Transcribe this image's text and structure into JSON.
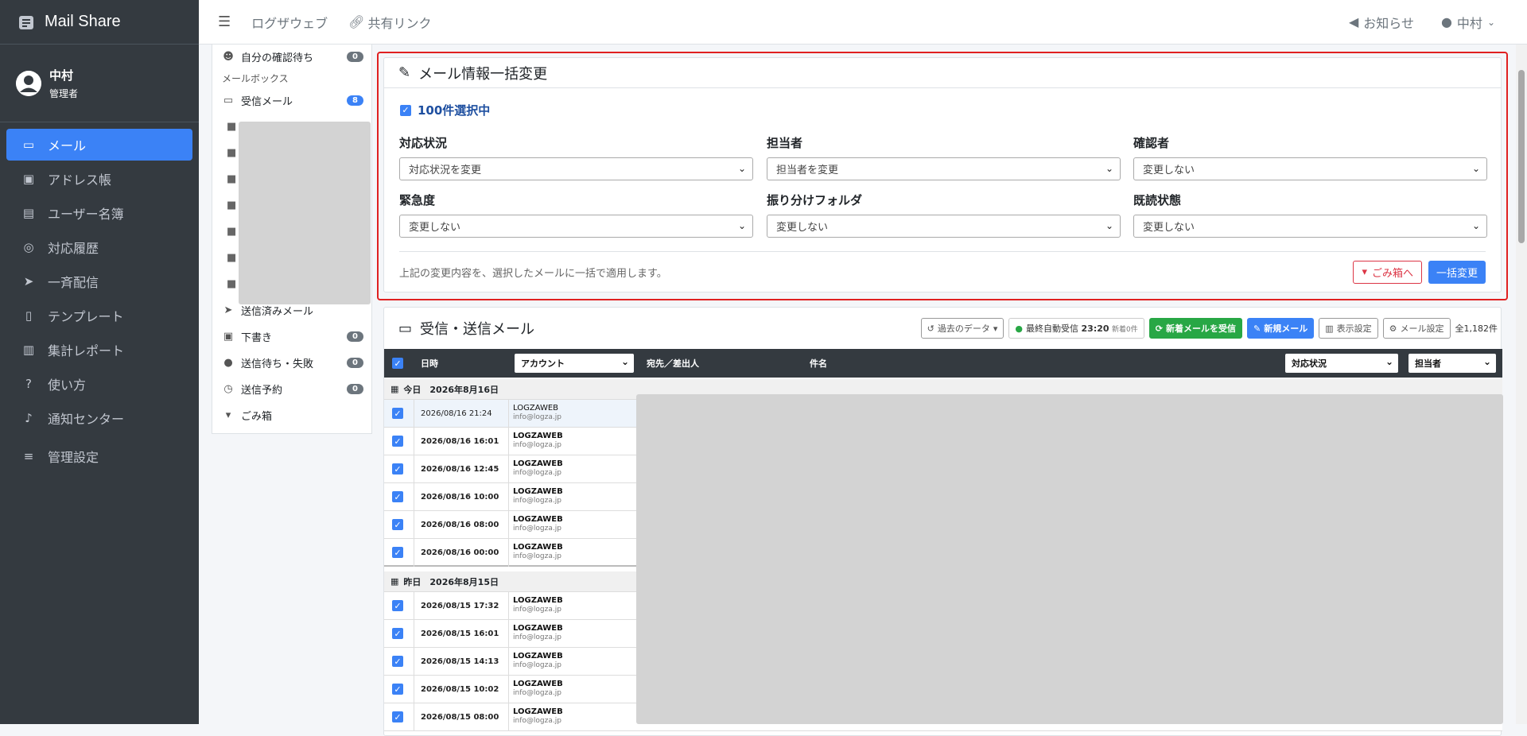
{
  "app": {
    "title": "Mail Share"
  },
  "user": {
    "name": "中村",
    "role": "管理者"
  },
  "sidebar": {
    "items": [
      {
        "label": "メール",
        "icon": "inbox-icon"
      },
      {
        "label": "アドレス帳",
        "icon": "address-book-icon"
      },
      {
        "label": "ユーザー名簿",
        "icon": "id-badge-icon"
      },
      {
        "label": "対応履歴",
        "icon": "headset-icon"
      },
      {
        "label": "一斉配信",
        "icon": "send-icon"
      },
      {
        "label": "テンプレート",
        "icon": "file-icon"
      },
      {
        "label": "集計レポート",
        "icon": "chart-icon"
      },
      {
        "label": "使い方",
        "icon": "help-icon"
      },
      {
        "label": "通知センター",
        "icon": "bell-icon"
      },
      {
        "label": "管理設定",
        "icon": "sliders-icon"
      }
    ]
  },
  "topbar": {
    "menu_icon": "hamburger-icon",
    "link1": "ログザウェブ",
    "link2": "共有リンク",
    "notice": "お知らせ",
    "user": "中村"
  },
  "folders": {
    "my_confirm": {
      "label": "自分の確認待ち",
      "count": "0"
    },
    "mailbox_heading": "メールボックス",
    "inbox": {
      "label": "受信メール",
      "count": "8"
    },
    "sent": {
      "label": "送信済みメール"
    },
    "drafts": {
      "label": "下書き",
      "count": "0"
    },
    "failed": {
      "label": "送信待ち・失敗",
      "count": "0"
    },
    "scheduled": {
      "label": "送信予約",
      "count": "0"
    },
    "trash": {
      "label": "ごみ箱"
    }
  },
  "bulk": {
    "title": "メール情報一括変更",
    "selected": "100件選択中",
    "fields": {
      "status": {
        "label": "対応状況",
        "value": "対応状況を変更"
      },
      "assignee": {
        "label": "担当者",
        "value": "担当者を変更"
      },
      "confirmer": {
        "label": "確認者",
        "value": "変更しない"
      },
      "urgency": {
        "label": "緊急度",
        "value": "変更しない"
      },
      "folder": {
        "label": "振り分けフォルダ",
        "value": "変更しない"
      },
      "read": {
        "label": "既読状態",
        "value": "変更しない"
      }
    },
    "note": "上記の変更内容を、選択したメールに一括で適用します。",
    "trash_button": "ごみ箱へ",
    "apply_button": "一括変更"
  },
  "mail": {
    "title": "受信・送信メール",
    "past_data": "過去のデータ",
    "auto_label": "最終自動受信",
    "auto_time": "23:20",
    "auto_new": "新着0件",
    "fetch_button": "新着メールを受信",
    "new_button": "新規メール",
    "display_button": "表示設定",
    "settings_button": "メール設定",
    "total": "全1,182件",
    "columns": {
      "date": "日時",
      "account": "アカウント",
      "to_from": "宛先／差出人",
      "subject": "件名",
      "status": "対応状況",
      "assignee": "担当者"
    },
    "groups": [
      {
        "label": "今日　2026年8月16日"
      },
      {
        "label": "昨日　2026年8月15日"
      }
    ],
    "rows_today": [
      {
        "date": "2026/08/16 21:24",
        "account": "LOGZAWEB",
        "email": "info@logza.jp"
      },
      {
        "date": "2026/08/16 16:01",
        "account": "LOGZAWEB",
        "email": "info@logza.jp"
      },
      {
        "date": "2026/08/16 12:45",
        "account": "LOGZAWEB",
        "email": "info@logza.jp"
      },
      {
        "date": "2026/08/16 10:00",
        "account": "LOGZAWEB",
        "email": "info@logza.jp"
      },
      {
        "date": "2026/08/16 08:00",
        "account": "LOGZAWEB",
        "email": "info@logza.jp"
      },
      {
        "date": "2026/08/16 00:00",
        "account": "LOGZAWEB",
        "email": "info@logza.jp"
      }
    ],
    "rows_yesterday": [
      {
        "date": "2026/08/15 17:32",
        "account": "LOGZAWEB",
        "email": "info@logza.jp"
      },
      {
        "date": "2026/08/15 16:01",
        "account": "LOGZAWEB",
        "email": "info@logza.jp"
      },
      {
        "date": "2026/08/15 14:13",
        "account": "LOGZAWEB",
        "email": "info@logza.jp"
      },
      {
        "date": "2026/08/15 10:02",
        "account": "LOGZAWEB",
        "email": "info@logza.jp"
      },
      {
        "date": "2026/08/15 08:00",
        "account": "LOGZAWEB",
        "email": "info@logza.jp"
      }
    ]
  },
  "colors": {
    "sidebar": "#343a40",
    "accent": "#3b82f6",
    "danger": "#dc3545",
    "success": "#28a745"
  }
}
